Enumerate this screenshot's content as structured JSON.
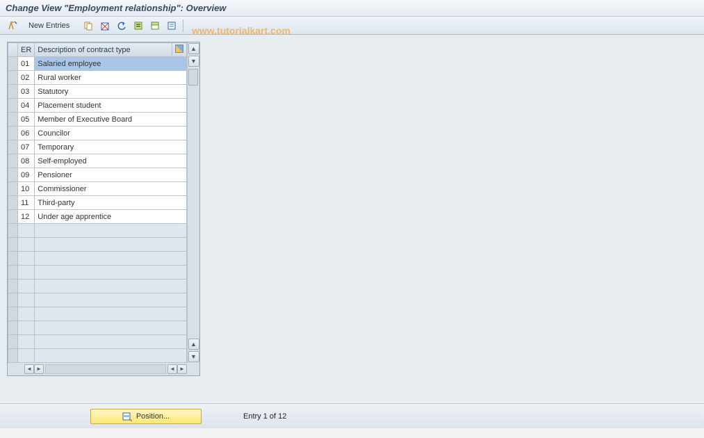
{
  "title": "Change View \"Employment relationship\": Overview",
  "toolbar": {
    "new_entries": "New Entries"
  },
  "watermark": "www.tutorialkart.com",
  "table": {
    "headers": {
      "er": "ER",
      "desc": "Description of contract type"
    },
    "rows": [
      {
        "er": "01",
        "desc": "Salaried employee"
      },
      {
        "er": "02",
        "desc": "Rural worker"
      },
      {
        "er": "03",
        "desc": "Statutory"
      },
      {
        "er": "04",
        "desc": "Placement student"
      },
      {
        "er": "05",
        "desc": "Member of Executive Board"
      },
      {
        "er": "06",
        "desc": "Councilor"
      },
      {
        "er": "07",
        "desc": "Temporary"
      },
      {
        "er": "08",
        "desc": "Self-employed"
      },
      {
        "er": "09",
        "desc": "Pensioner"
      },
      {
        "er": "10",
        "desc": "Commissioner"
      },
      {
        "er": "11",
        "desc": "Third-party"
      },
      {
        "er": "12",
        "desc": "Under age apprentice"
      }
    ],
    "empty_rows": 10
  },
  "footer": {
    "position_label": "Position...",
    "entry_text": "Entry 1 of 12"
  }
}
